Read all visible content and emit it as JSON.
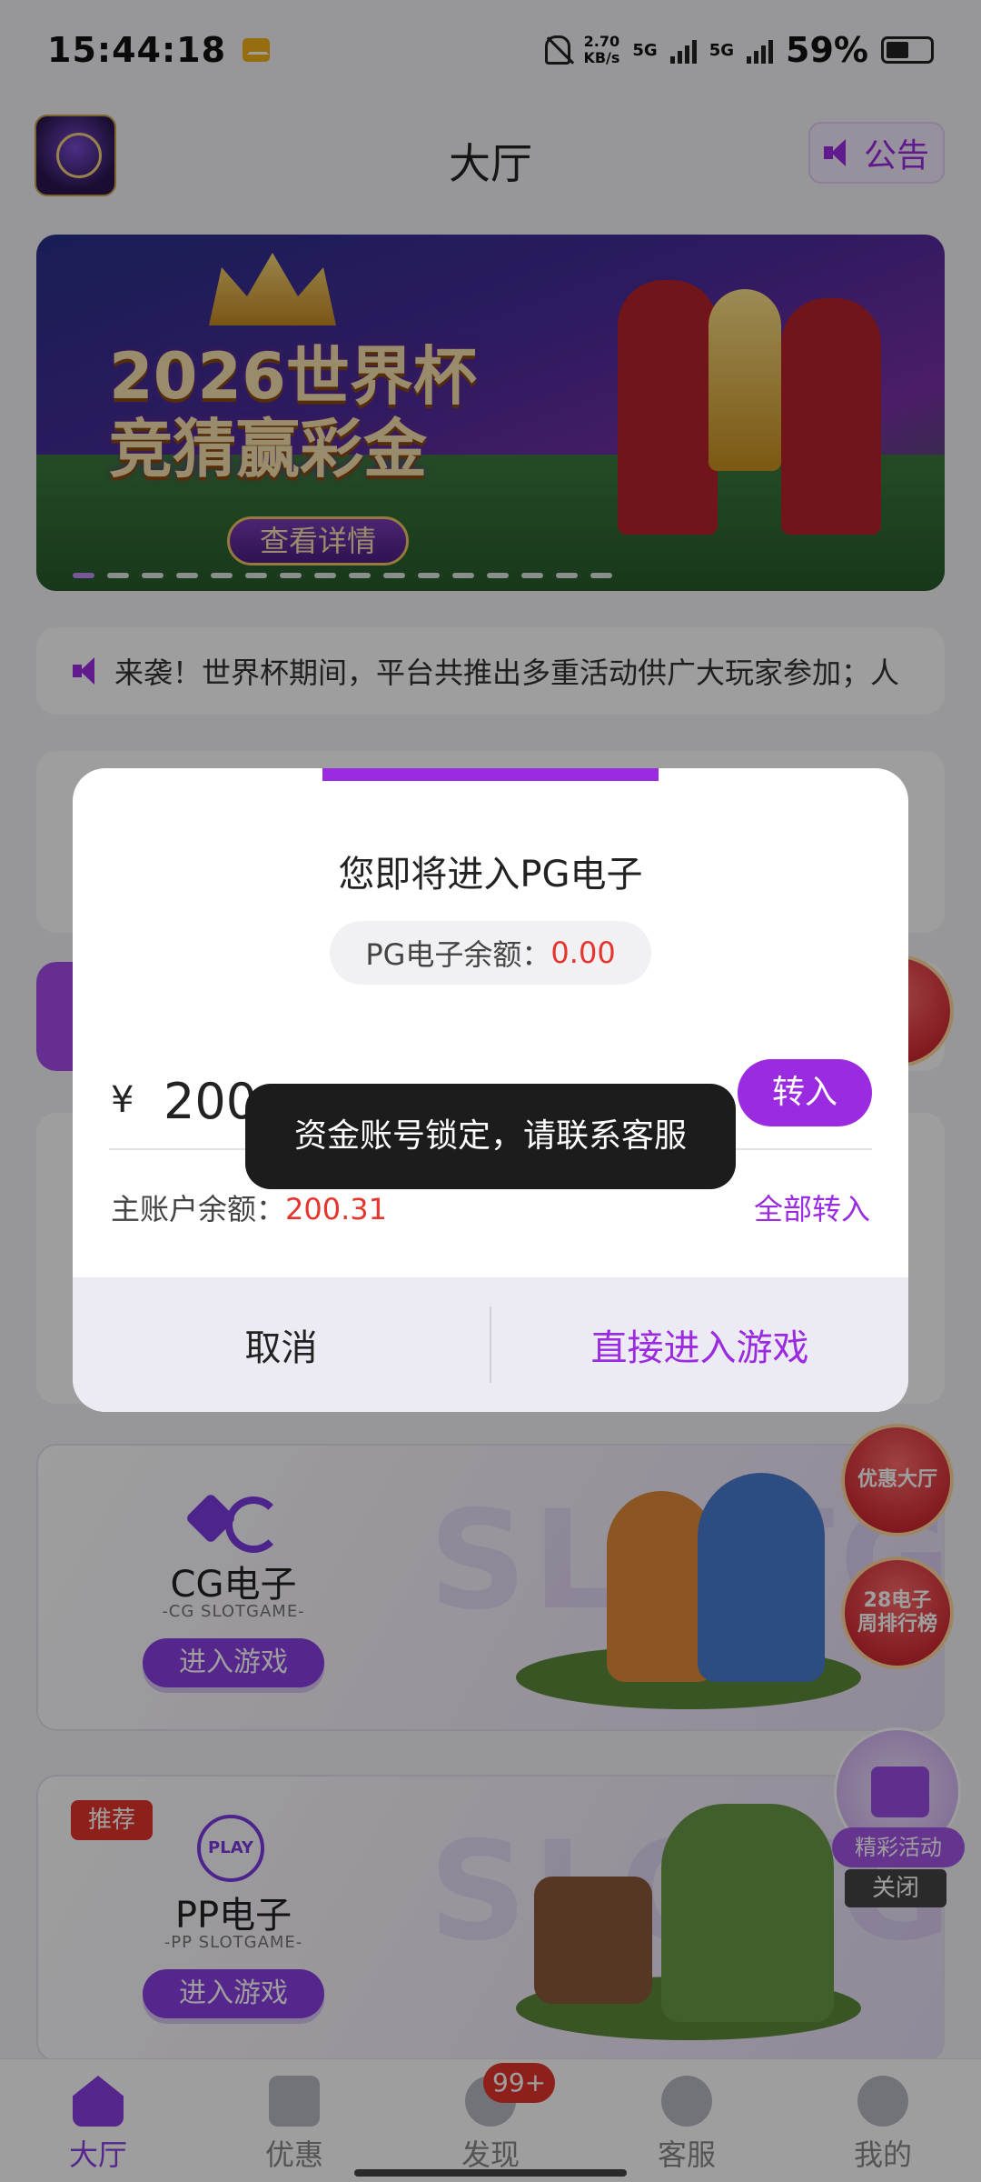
{
  "status_bar": {
    "time": "15:44:18",
    "speed_value": "2.70",
    "speed_unit": "KB/s",
    "network_1": "5G",
    "network_2": "5G",
    "battery": "59%"
  },
  "header": {
    "title": "大厅",
    "notice_label": "公告"
  },
  "banner": {
    "title_line1": "2026世界杯",
    "title_line2": "竞猜赢彩金",
    "cta": "查看详情"
  },
  "marquee": {
    "text": "来袭！世界杯期间，平台共推出多重活动供广大玩家参加；人"
  },
  "games": [
    {
      "title": "CG电子",
      "subtitle": "-CG SLOTGAME-",
      "enter_label": "进入游戏",
      "watermark": "SLOTGAME"
    },
    {
      "tag": "推荐",
      "logo_text": "PLAY",
      "title": "PP电子",
      "subtitle": "-PP SLOTGAME-",
      "enter_label": "进入游戏",
      "watermark": "SLOTGAME"
    }
  ],
  "floating": {
    "promo_hall": "优惠大厅",
    "ranking": "28电子\n周排行榜",
    "activity": "精彩活动",
    "close": "关闭"
  },
  "bottom_nav": {
    "items": [
      {
        "label": "大厅",
        "active": true
      },
      {
        "label": "优惠",
        "active": false
      },
      {
        "label": "发现",
        "active": false,
        "badge": "99+"
      },
      {
        "label": "客服",
        "active": false
      },
      {
        "label": "我的",
        "active": false
      }
    ]
  },
  "dialog": {
    "title": "您即将进入PG电子",
    "balance_label": "PG电子余额：",
    "balance_value": "0.00",
    "currency": "¥",
    "amount_value": "200",
    "transfer_label": "转入",
    "main_balance_label": "主账户余额：",
    "main_balance_value": "200.31",
    "transfer_all_label": "全部转入",
    "cancel_label": "取消",
    "enter_label": "直接进入游戏"
  },
  "toast": {
    "text": "资金账号锁定，请联系客服"
  },
  "colors": {
    "accent": "#9b2be0",
    "value_red": "#e5352c",
    "toast_bg": "#1c1c1c"
  }
}
